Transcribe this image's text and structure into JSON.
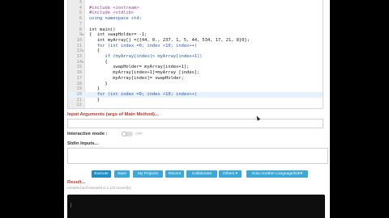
{
  "code_lines": [
    {
      "n": "3",
      "text": ""
    },
    {
      "n": "4",
      "text": "#include <iostream>"
    },
    {
      "n": "5",
      "text": "#include <stdlib>"
    },
    {
      "n": "6",
      "text": "using namespace std;"
    },
    {
      "n": "7",
      "text": ""
    },
    {
      "n": "8",
      "text": "int main()"
    },
    {
      "n": "9",
      "text": "{  int swapHolder= -1;"
    },
    {
      "n": "10",
      "text": "   int myArray[] ={{44, 0., 237, 1, 5, 44, 534, 17, 21, 8}0};"
    },
    {
      "n": "11",
      "text": "   for (int index =0; index <10; index++)"
    },
    {
      "n": "12",
      "text": "   {"
    },
    {
      "n": "13",
      "text": "      if (myArray[index]> myArray[index+1])"
    },
    {
      "n": "14",
      "text": "      {"
    },
    {
      "n": "15",
      "text": "         swapHolder= myArray[index+1];"
    },
    {
      "n": "16",
      "text": "         myArray[index+1]=myArray [index];"
    },
    {
      "n": "17",
      "text": "         myArray[index]= swapHolder;"
    },
    {
      "n": "18",
      "text": "      }"
    },
    {
      "n": "19",
      "text": "   }"
    },
    {
      "n": "20",
      "text": "   for (int index =0; index <10; index++)"
    },
    {
      "n": "21",
      "text": "   }"
    },
    {
      "n": "22",
      "text": ""
    }
  ],
  "input_arguments_label": "Input Arguments (args of Main Method)...",
  "interactive_mode_label": "Interactive mode :",
  "interactive_mode_state": "OFF",
  "stdin_label": "Stdin Inputs...",
  "buttons": {
    "execute": "Execute",
    "save": "Save",
    "my_projects": "My Projects",
    "recent": "Recent",
    "collaborate": "Collaborate",
    "others": "Others ▾",
    "other_lang": "Goto Another Language/IDE▾"
  },
  "result_label": "Result...",
  "compiled_text": "compiled and executed in 1.123 second(s)",
  "colors": {
    "accent_button": "#3ba8d8",
    "label_red": "#c0392b",
    "background": "#000000"
  }
}
